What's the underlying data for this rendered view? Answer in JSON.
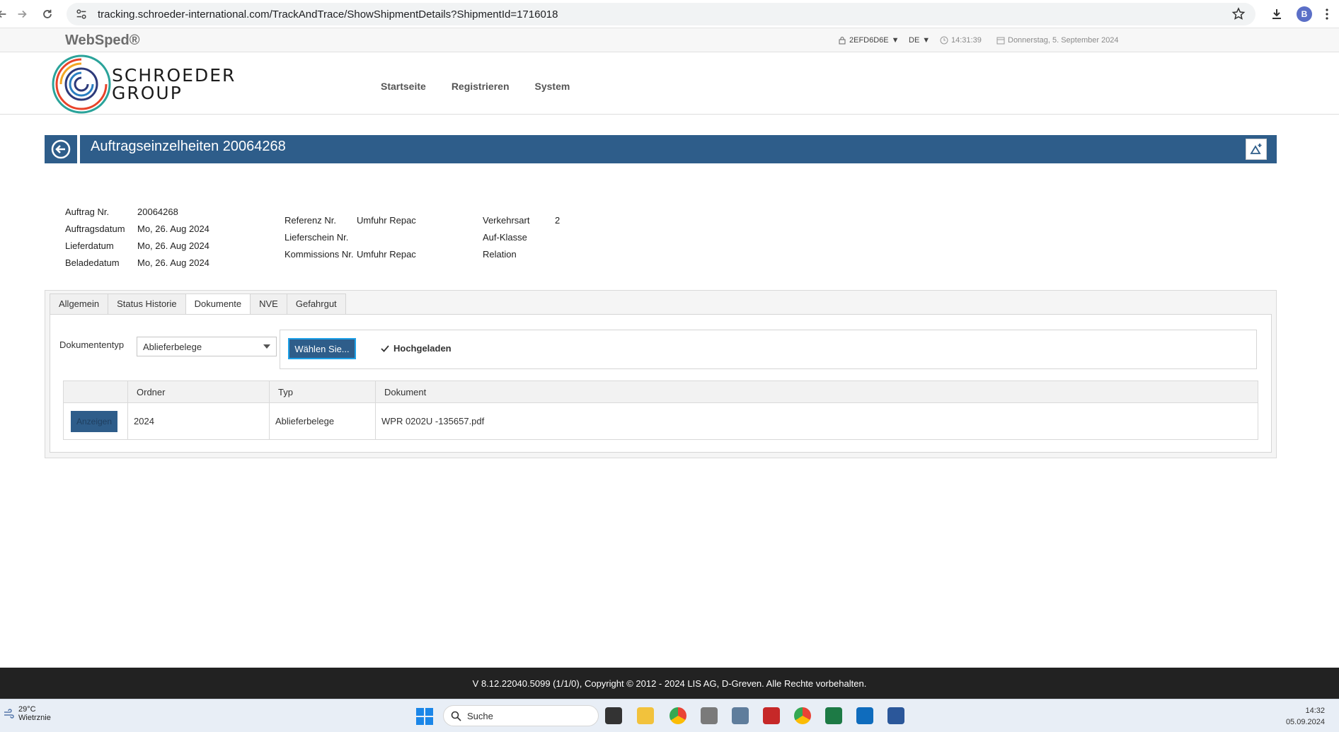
{
  "browser": {
    "url": "tracking.schroeder-international.com/TrackAndTrace/ShowShipmentDetails?ShipmentId=1716018",
    "profile_initial": "B"
  },
  "strip": {
    "app_name": "WebSped®",
    "user_code": "2EFD6D6E",
    "language": "DE",
    "time": "14:31:39",
    "date": "Donnerstag, 5. September 2024"
  },
  "header": {
    "logo_line1": "SCHROEDER",
    "logo_line2": "GROUP",
    "nav": [
      "Startseite",
      "Registrieren",
      "System"
    ]
  },
  "page": {
    "title": "Auftragseinzelheiten 20064268"
  },
  "details": {
    "col1": [
      {
        "label": "Auftrag Nr.",
        "value": "20064268"
      },
      {
        "label": "Auftragsdatum",
        "value": "Mo, 26. Aug 2024"
      },
      {
        "label": "Lieferdatum",
        "value": "Mo, 26. Aug 2024"
      },
      {
        "label": "Beladedatum",
        "value": "Mo, 26. Aug 2024"
      }
    ],
    "col2": [
      {
        "label": "Referenz Nr.",
        "value": "Umfuhr Repac"
      },
      {
        "label": "Lieferschein Nr.",
        "value": ""
      },
      {
        "label": "Kommissions Nr.",
        "value": "Umfuhr Repac"
      }
    ],
    "col3": [
      {
        "label": "Verkehrsart",
        "value": "2"
      },
      {
        "label": "Auf-Klasse",
        "value": ""
      },
      {
        "label": "Relation",
        "value": ""
      }
    ]
  },
  "tabs": [
    "Allgemein",
    "Status Historie",
    "Dokumente",
    "NVE",
    "Gefahrgut"
  ],
  "active_tab": "Dokumente",
  "documents": {
    "type_label": "Dokumententyp",
    "type_selected": "Ablieferbelege",
    "choose_label": "Wählen Sie...",
    "uploaded_label": "Hochgeladen",
    "columns": [
      "",
      "Ordner",
      "Typ",
      "Dokument"
    ],
    "rows": [
      {
        "action": "Anzeigen",
        "folder": "2024",
        "type": "Ablieferbelege",
        "document": "WPR 0202U -135657.pdf"
      }
    ]
  },
  "footer": {
    "text": "V 8.12.22040.5099 (1/1/0), Copyright © 2012 - 2024 LIS AG, D-Greven. Alle Rechte vorbehalten."
  },
  "taskbar": {
    "temperature": "29°C",
    "weather": "Wietrznie",
    "search_placeholder": "Suche",
    "clock_time": "14:32",
    "clock_date": "05.09.2024"
  },
  "colors": {
    "brand_blue": "#2e5d8a",
    "footer_bg": "#222222"
  }
}
